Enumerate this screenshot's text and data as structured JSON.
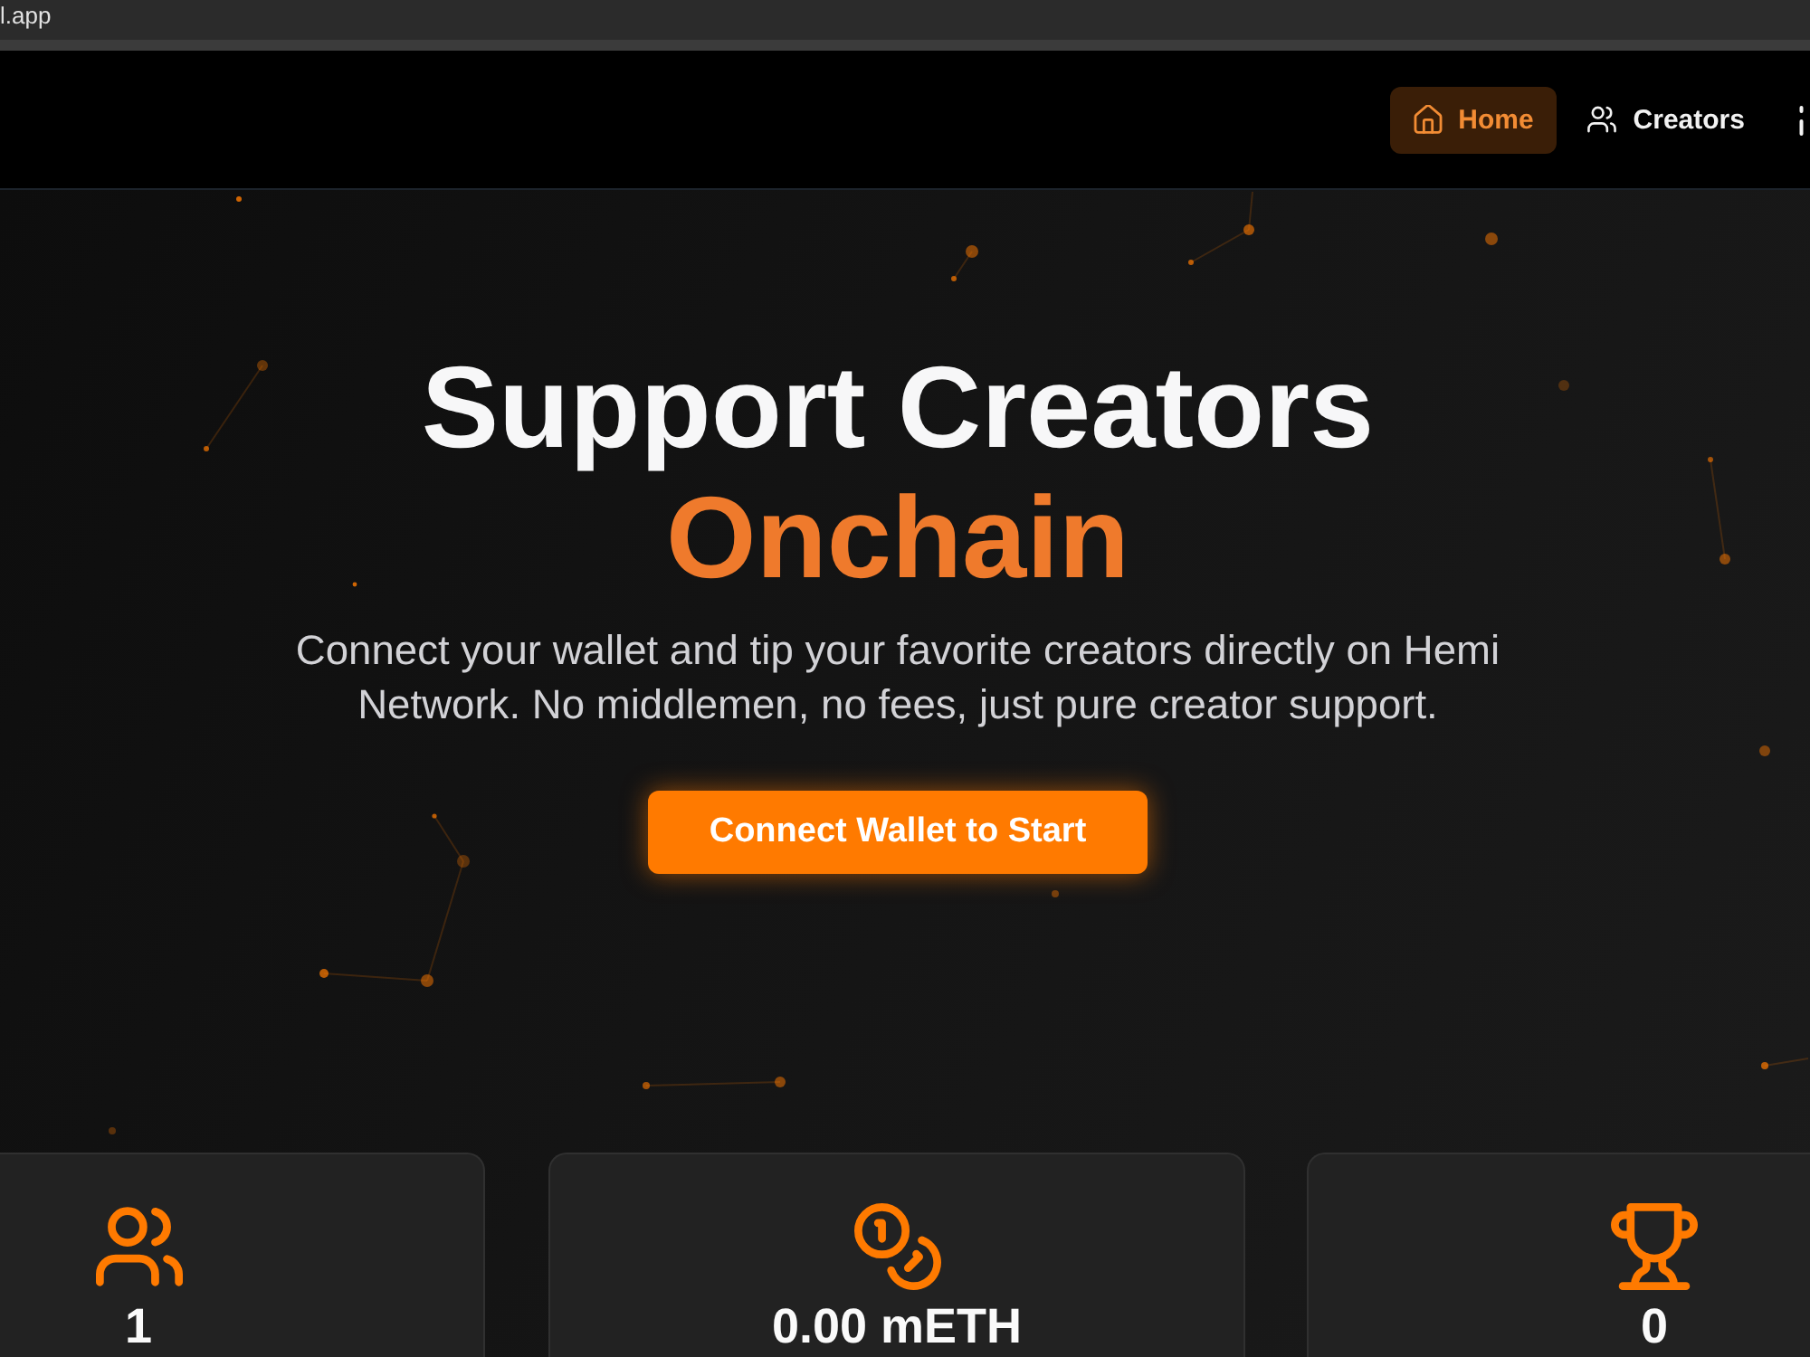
{
  "browser": {
    "url": "l.app"
  },
  "nav": {
    "items": [
      {
        "label": "Home",
        "selected": true
      },
      {
        "label": "Creators",
        "selected": false
      }
    ]
  },
  "hero": {
    "title": "Support Creators",
    "highlight": "Onchain",
    "description": "Connect your wallet and tip your favorite creators directly on Hemi Network. No middlemen, no fees, just pure creator support.",
    "cta": "Connect Wallet to Start"
  },
  "stats": [
    {
      "value": "1"
    },
    {
      "value": "0.00 mETH"
    },
    {
      "value": "0"
    }
  ]
}
